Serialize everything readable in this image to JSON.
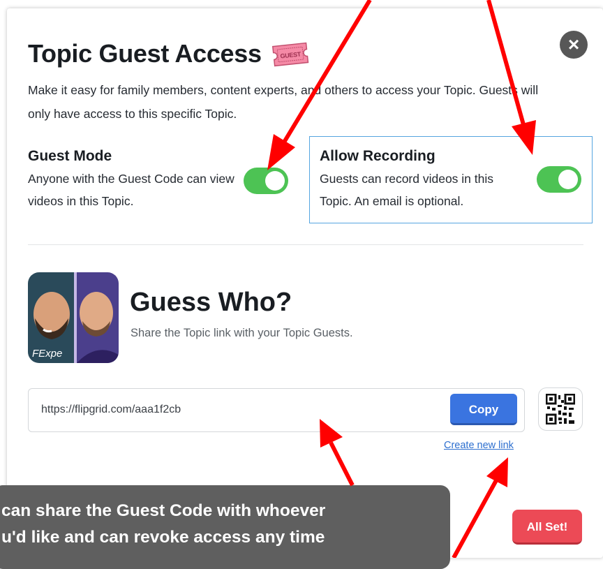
{
  "dialog": {
    "title": "Topic Guest Access",
    "ticket_label": "GUEST",
    "description": "Make it easy for family members, content experts, and others to access your Topic. Guests will only have access to this specific Topic.",
    "close_label": "×"
  },
  "guest_mode": {
    "heading": "Guest Mode",
    "description": "Anyone with the Guest Code can view videos in this Topic.",
    "enabled": true
  },
  "allow_recording": {
    "heading": "Allow Recording",
    "description": "Guests can record videos in this Topic. An email is optional.",
    "enabled": true
  },
  "topic": {
    "avatar_text": "FExpe",
    "name": "Guess Who?",
    "subtitle": "Share the Topic link with your Topic Guests."
  },
  "share": {
    "link": "https://flipgrid.com/aaa1f2cb",
    "copy_label": "Copy",
    "qr_icon": "qr-code-icon",
    "create_new_label": "Create new link"
  },
  "footer": {
    "done_label": "All Set!"
  },
  "annotation": {
    "line1": "can share the Guest Code with whoever",
    "line2": "u'd like and can revoke access any time",
    "arrow_color": "#ff0000"
  },
  "colors": {
    "toggle_on": "#4dc354",
    "copy_button": "#3a74e0",
    "done_button": "#ec4a56",
    "highlight_border": "#55a5e0"
  }
}
